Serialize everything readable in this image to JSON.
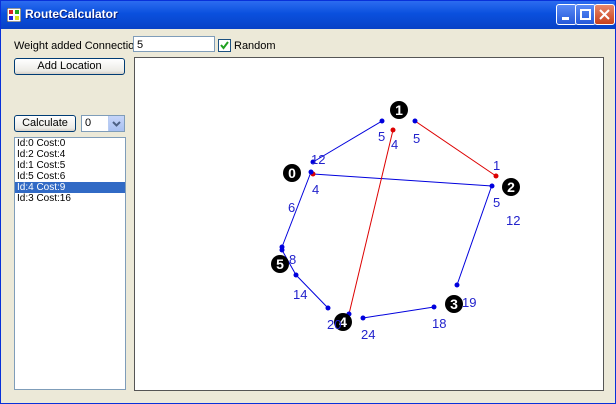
{
  "window": {
    "title": "RouteCalculator"
  },
  "form": {
    "weight_label": "Weight added Connection",
    "weight_value": "5",
    "random_label": "Random",
    "random_checked": true,
    "add_location_label": "Add Location",
    "calculate_label": "Calculate",
    "start_select_value": "0"
  },
  "results": [
    "Id:0 Cost:0",
    "Id:2 Cost:4",
    "Id:1 Cost:5",
    "Id:5 Cost:6",
    "Id:4 Cost:9",
    "Id:3 Cost:16"
  ],
  "selected_result": 4,
  "graph": {
    "nodes": [
      {
        "id": "0",
        "label": "0"
      },
      {
        "id": "1",
        "label": "1"
      },
      {
        "id": "2",
        "label": "2"
      },
      {
        "id": "3",
        "label": "3"
      },
      {
        "id": "4",
        "label": "4"
      },
      {
        "id": "5",
        "label": "5"
      }
    ],
    "edge_labels": [
      "5",
      "4",
      "5",
      "12",
      "4",
      "1",
      "5",
      "12",
      "6",
      "8",
      "14",
      "19",
      "18",
      "20",
      "24"
    ],
    "colors": {
      "normal_edge": "#0000DD",
      "path_edge": "#DD0000",
      "node": "#000000",
      "label": "#2222CC"
    }
  }
}
